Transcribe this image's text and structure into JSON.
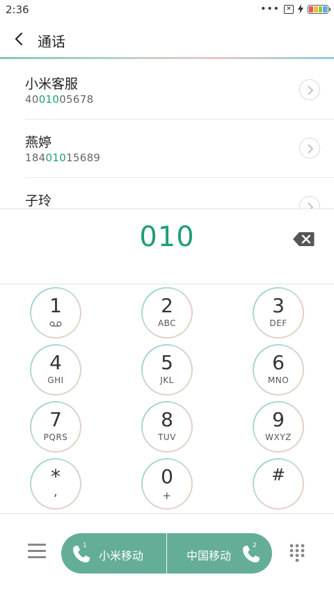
{
  "status": {
    "time": "2:36",
    "more_dots": "•••",
    "sim_label": "✕",
    "battery_colors": [
      "#e05a5a",
      "#f2b93b",
      "#8fc74a",
      "#5aa9e6"
    ]
  },
  "header": {
    "title": "通话"
  },
  "results": [
    {
      "name": "小米客服",
      "number_pre": "40",
      "number_hl": "010",
      "number_post": "05678"
    },
    {
      "name": "燕婷",
      "number_pre": "184",
      "number_hl": "010",
      "number_post": "15689"
    },
    {
      "name": "子玲",
      "number_pre": "",
      "number_hl": "",
      "number_post": ""
    }
  ],
  "dialed": "010",
  "keys": [
    {
      "digit": "1",
      "letters": ""
    },
    {
      "digit": "2",
      "letters": "ABC"
    },
    {
      "digit": "3",
      "letters": "DEF"
    },
    {
      "digit": "4",
      "letters": "GHI"
    },
    {
      "digit": "5",
      "letters": "JKL"
    },
    {
      "digit": "6",
      "letters": "MNO"
    },
    {
      "digit": "7",
      "letters": "PQRS"
    },
    {
      "digit": "8",
      "letters": "TUV"
    },
    {
      "digit": "9",
      "letters": "WXYZ"
    },
    {
      "digit": "*",
      "letters": ","
    },
    {
      "digit": "0",
      "letters": "+"
    },
    {
      "digit": "#",
      "letters": ""
    }
  ],
  "call": {
    "sim1_label": "小米移动",
    "sim1_badge": "1",
    "sim2_label": "中国移动",
    "sim2_badge": "2"
  },
  "colors": {
    "accent": "#1f9e78",
    "call_button": "#64ad99"
  }
}
